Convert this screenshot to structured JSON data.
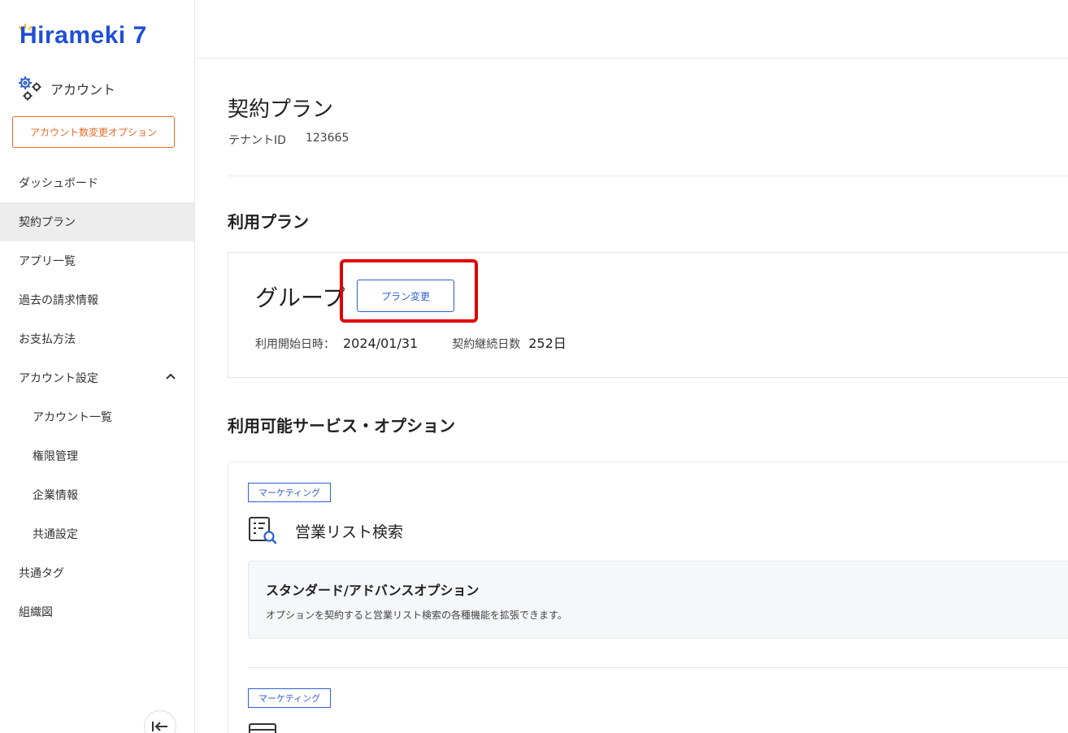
{
  "logo": {
    "text": "Hirameki 7"
  },
  "sidebar": {
    "account_label": "アカウント",
    "option_button": "アカウント数変更オプション",
    "items": [
      {
        "label": "ダッシュボード"
      },
      {
        "label": "契約プラン"
      },
      {
        "label": "アプリ一覧"
      },
      {
        "label": "過去の請求情報"
      },
      {
        "label": "お支払方法"
      },
      {
        "label": "アカウント設定"
      },
      {
        "label": "アカウント一覧"
      },
      {
        "label": "権限管理"
      },
      {
        "label": "企業情報"
      },
      {
        "label": "共通設定"
      },
      {
        "label": "共通タグ"
      },
      {
        "label": "組織図"
      }
    ]
  },
  "page": {
    "title": "契約プラン",
    "tenant_label": "テナントID",
    "tenant_id": "123665"
  },
  "plan_section": {
    "title": "利用プラン",
    "plan_name": "グループ",
    "change_button": "プラン変更",
    "start_label": "利用開始日時：",
    "start_value": "2024/01/31",
    "days_label": "契約継続日数",
    "days_value": "252日"
  },
  "services_section": {
    "title": "利用可能サービス・オプション",
    "services": [
      {
        "tag": "マーケティング",
        "name": "営業リスト検索",
        "option_title": "スタンダード/アドバンスオプション",
        "option_desc": "オプションを契約すると営業リスト検索の各種機能を拡張できます。"
      },
      {
        "tag": "マーケティング"
      }
    ]
  },
  "colors": {
    "brand_blue": "#1f4fd6",
    "accent_orange": "#e86a2a",
    "highlight_red": "#e00000"
  }
}
